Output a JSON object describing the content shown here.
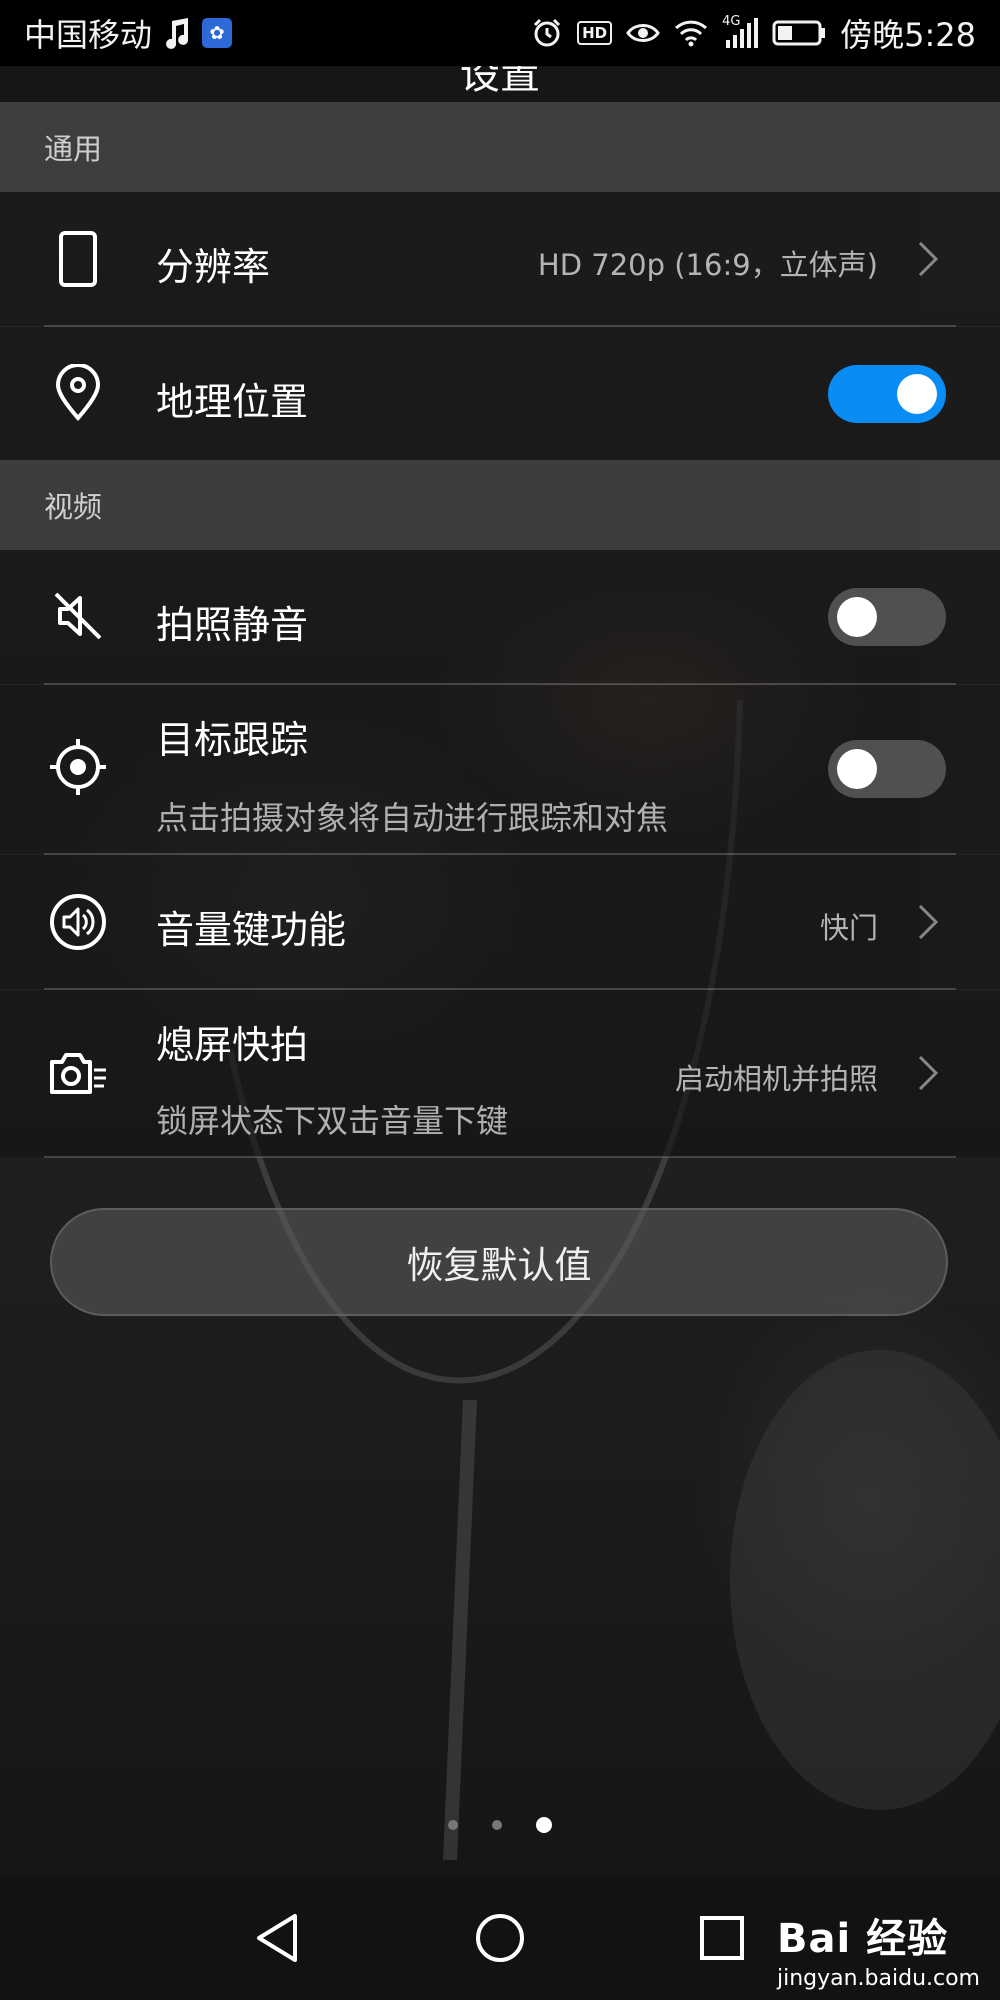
{
  "status_bar": {
    "carrier": "中国移动",
    "network": "4G",
    "time": "傍晚5:28",
    "hd_badge": "HD"
  },
  "header": {
    "title": "设置"
  },
  "sections": {
    "general": "通用",
    "video": "视频"
  },
  "rows": {
    "resolution": {
      "label": "分辨率",
      "value": "HD 720p (16:9，立体声)"
    },
    "location": {
      "label": "地理位置",
      "toggle_on": true
    },
    "mute": {
      "label": "拍照静音",
      "toggle_on": false
    },
    "tracking": {
      "label": "目标跟踪",
      "sub": "点击拍摄对象将自动进行跟踪和对焦",
      "toggle_on": false
    },
    "volume_key": {
      "label": "音量键功能",
      "value": "快门"
    },
    "snapshot": {
      "label": "熄屏快拍",
      "sub": "锁屏状态下双击音量下键",
      "value": "启动相机并拍照"
    }
  },
  "restore_button": {
    "label": "恢复默认值"
  },
  "page_indicator": {
    "total": 3,
    "active": 3
  },
  "watermark": {
    "main": "Bai 经验",
    "sub": "jingyan.baidu.com"
  },
  "colors": {
    "toggle_on": "#0a8cf5",
    "toggle_off": "#505050"
  }
}
